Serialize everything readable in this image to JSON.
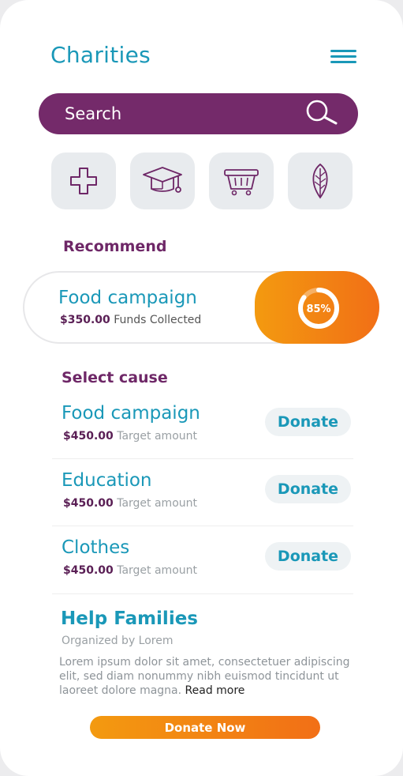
{
  "header": {
    "title": "Charities",
    "menu_icon": "hamburger-menu-icon"
  },
  "search": {
    "placeholder": "Search",
    "icon": "search-icon"
  },
  "categories": [
    {
      "name": "health",
      "icon": "medical-cross-icon"
    },
    {
      "name": "education",
      "icon": "graduation-cap-icon"
    },
    {
      "name": "shopping",
      "icon": "shopping-basket-icon"
    },
    {
      "name": "environment",
      "icon": "leaf-icon"
    }
  ],
  "recommend": {
    "heading": "Recommend",
    "card": {
      "title": "Food campaign",
      "amount": "$350.00",
      "amount_label": "Funds Collected",
      "progress_percent": 85,
      "progress_label": "85%"
    }
  },
  "causes": {
    "heading": "Select cause",
    "items": [
      {
        "name": "Food campaign",
        "amount": "$450.00",
        "amount_label": "Target amount",
        "button": "Donate"
      },
      {
        "name": "Education",
        "amount": "$450.00",
        "amount_label": "Target amount",
        "button": "Donate"
      },
      {
        "name": "Clothes",
        "amount": "$450.00",
        "amount_label": "Target amount",
        "button": "Donate"
      }
    ]
  },
  "featured": {
    "title": "Help Families",
    "organizer": "Organized by Lorem",
    "description": "Lorem ipsum dolor sit amet, consectetuer adipiscing elit, sed diam nonummy nibh euismod tincidunt ut laoreet dolore magna.",
    "read_more": "Read more",
    "button": "Donate Now"
  },
  "colors": {
    "primary": "#1a98b8",
    "accent_purple": "#742a6a",
    "accent_orange": "#f39a10",
    "accent_orange_dark": "#f26f16"
  }
}
